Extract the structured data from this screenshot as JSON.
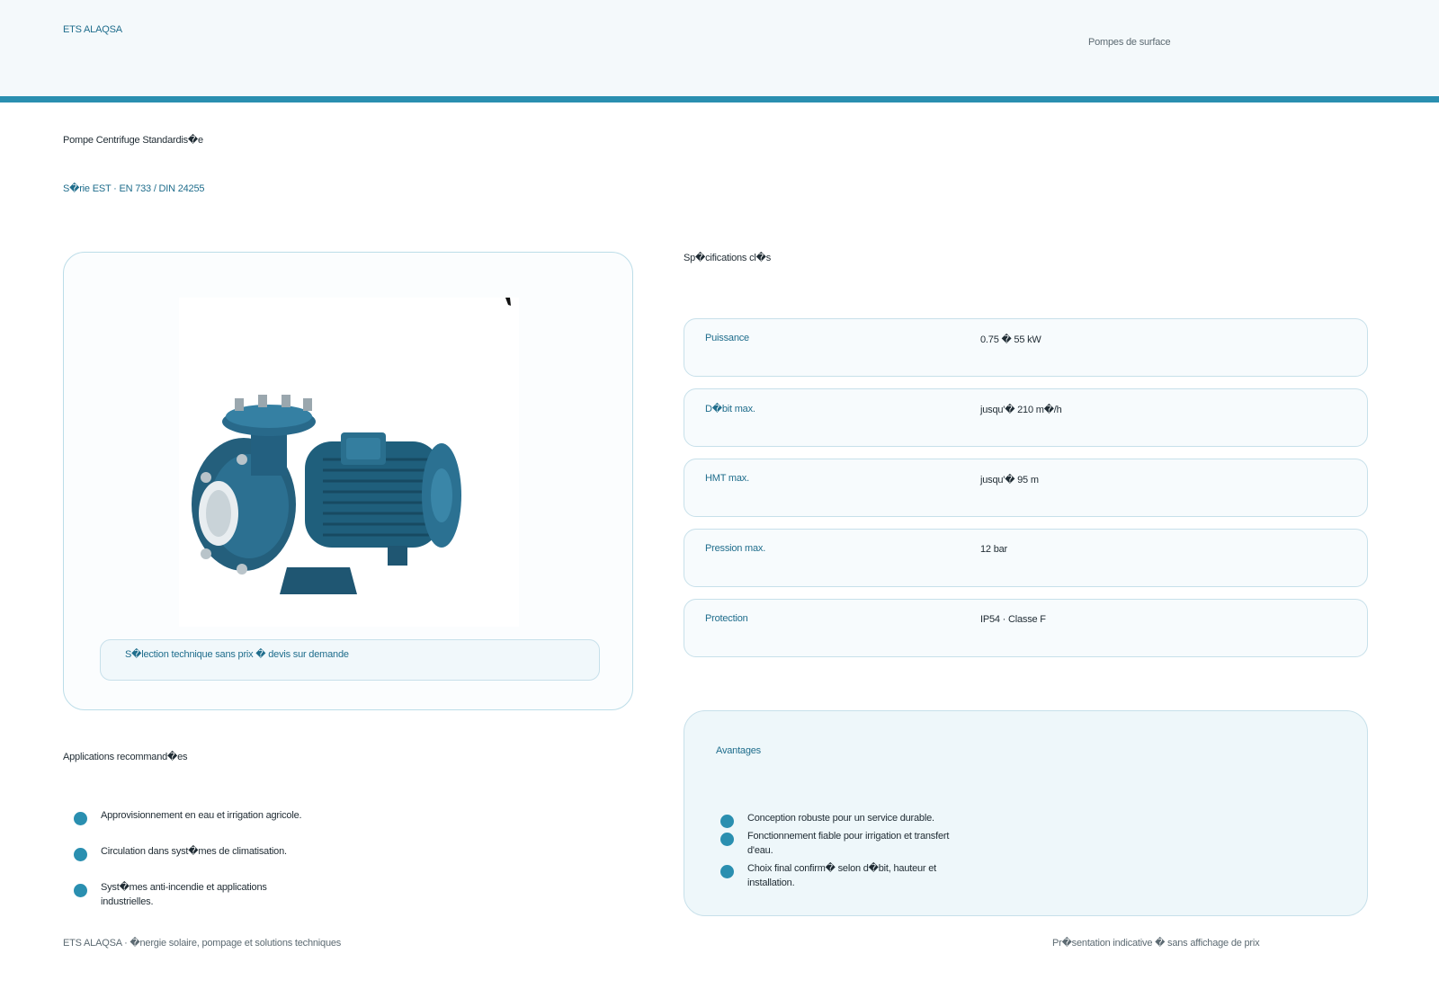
{
  "header": {
    "brand": "ETS ALAQSA",
    "category": "Pompes de surface",
    "accent_color": "#2a8fb0"
  },
  "product": {
    "title": "Pompe Centrifuge Standardis�e",
    "series": "S�rie EST · EN 733 / DIN 24255",
    "image_icon": "centrifugal-pump-image",
    "note": "S�lection technique sans prix � devis sur demande"
  },
  "specs": {
    "title": "Sp�cifications cl�s",
    "rows": [
      {
        "label": "Puissance",
        "value": "0.75 � 55 kW"
      },
      {
        "label": "D�bit max.",
        "value": "jusqu'� 210 m�/h"
      },
      {
        "label": "HMT max.",
        "value": "jusqu'� 95 m"
      },
      {
        "label": "Pression max.",
        "value": "12 bar"
      },
      {
        "label": "Protection",
        "value": "IP54 · Classe F"
      }
    ]
  },
  "applications": {
    "title": "Applications recommand�es",
    "items": [
      "Approvisionnement en eau et irrigation agricole.",
      "Circulation dans syst�mes de climatisation.",
      "Syst�mes anti-incendie et applications industrielles."
    ]
  },
  "advantages": {
    "title": "Avantages",
    "items": [
      "Conception robuste pour un service durable.",
      "Fonctionnement fiable pour irrigation et transfert d'eau.",
      "Choix final confirm� selon d�bit, hauteur et installation."
    ]
  },
  "footer": {
    "left": "ETS ALAQSA · �nergie solaire, pompage et solutions techniques",
    "right": "Pr�sentation indicative � sans affichage de prix"
  }
}
